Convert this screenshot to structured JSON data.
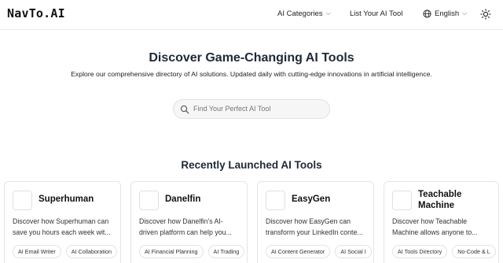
{
  "header": {
    "logo": "NavTo.AI",
    "nav": {
      "categories": "AI Categories",
      "list_tool": "List Your AI Tool",
      "language": "English"
    }
  },
  "hero": {
    "title": "Discover Game-Changing AI Tools",
    "subtitle": "Explore our comprehensive directory of AI solutions. Updated daily with cutting-edge innovations in artificial intelligence."
  },
  "search": {
    "placeholder": "Find Your Perfect AI Tool"
  },
  "recent": {
    "title": "Recently Launched AI Tools",
    "cards": [
      {
        "name": "Superhuman",
        "description": "Discover how Superhuman can save you hours each week wit...",
        "tags": [
          "AI Email Writer",
          "AI Collaboration"
        ]
      },
      {
        "name": "Danelfin",
        "description": "Discover how Danelfin's AI-driven platform can help you...",
        "tags": [
          "AI Financial Planning",
          "AI Trading"
        ]
      },
      {
        "name": "EasyGen",
        "description": "Discover how EasyGen can transform your LinkedIn conte...",
        "tags": [
          "AI Content Generator",
          "AI Social I"
        ]
      },
      {
        "name": "Teachable Machine",
        "description": "Discover how Teachable Machine allows anyone to...",
        "tags": [
          "AI Tools Directory",
          "No-Code & L"
        ]
      }
    ]
  }
}
